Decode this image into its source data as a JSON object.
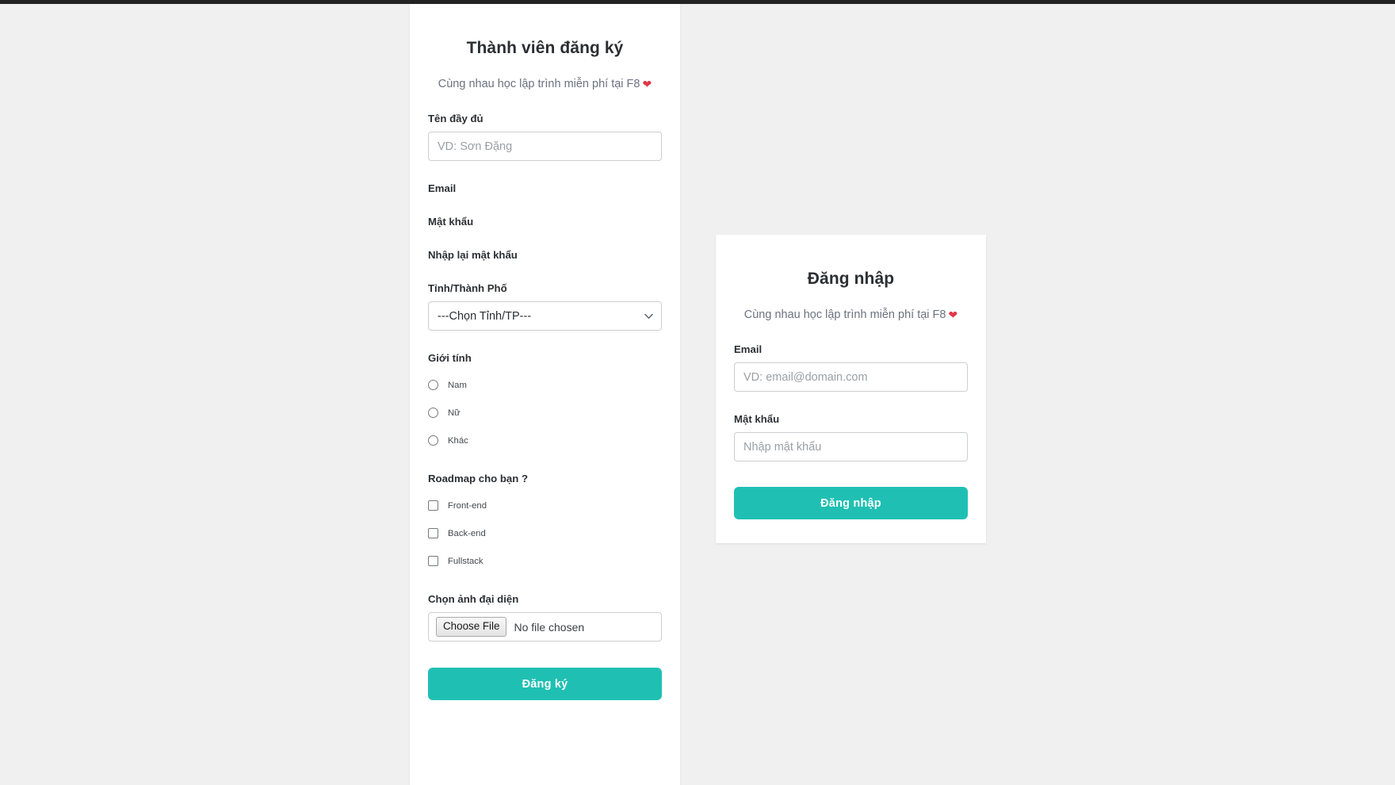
{
  "register": {
    "title": "Thành viên đăng ký",
    "subtitle": "Cùng nhau học lập trình miễn phí tại F8",
    "heart": "❤",
    "fields": {
      "fullname_label": "Tên đầy đủ",
      "fullname_placeholder": "VD: Sơn Đặng",
      "fullname_value": "",
      "email_label": "Email",
      "password_label": "Mật khẩu",
      "confirm_password_label": "Nhập lại mật khẩu",
      "province_label": "Tỉnh/Thành Phố",
      "province_selected": "---Chọn Tỉnh/TP---",
      "gender_label": "Giới tính",
      "roadmap_label": "Roadmap cho bạn ?",
      "avatar_label": "Chọn ảnh đại diện"
    },
    "gender_options": [
      {
        "label": "Nam",
        "checked": false
      },
      {
        "label": "Nữ",
        "checked": false
      },
      {
        "label": "Khác",
        "checked": false
      }
    ],
    "roadmap_options": [
      {
        "label": "Front-end",
        "checked": false
      },
      {
        "label": "Back-end",
        "checked": false
      },
      {
        "label": "Fullstack",
        "checked": false
      }
    ],
    "file_button_label": "Choose File",
    "file_status_text": "No file chosen",
    "submit_label": "Đăng ký"
  },
  "login": {
    "title": "Đăng nhập",
    "subtitle": "Cùng nhau học lập trình miễn phí tại F8",
    "heart": "❤",
    "email_label": "Email",
    "email_placeholder": "VD: email@domain.com",
    "email_value": "",
    "password_label": "Mật khẩu",
    "password_placeholder": "Nhập mật khẩu",
    "password_value": "",
    "submit_label": "Đăng nhập"
  },
  "colors": {
    "accent": "#1fc0b3",
    "page_background": "#f0f0f0",
    "card_background": "#ffffff",
    "heart": "#e0384a",
    "label_text": "#2b2f33",
    "muted_text": "#6b7280",
    "border": "#ccced1"
  }
}
